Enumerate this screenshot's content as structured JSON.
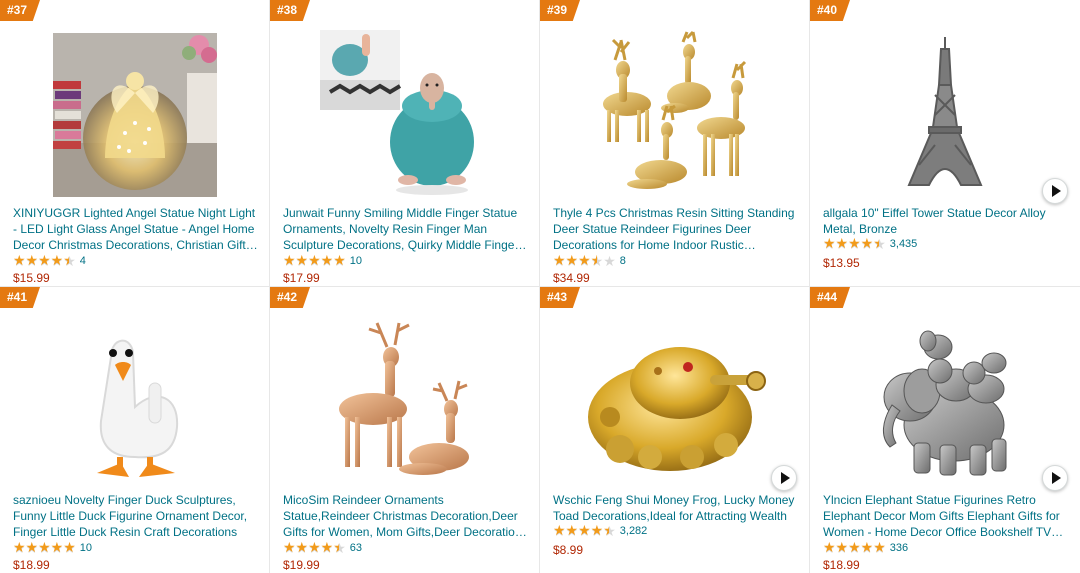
{
  "products": [
    {
      "rank": "#37",
      "title": "XINIYUGGR Lighted Angel Statue Night Light - LED Light Glass Angel Statue - Angel Home Decor Christmas Decorations, Christian Gifts, Angel Gifts, Memorial Gifts, Religious Gifts",
      "rating": 4.5,
      "count": "4",
      "price": "$15.99",
      "image": "angel-glass-night-light"
    },
    {
      "rank": "#38",
      "title": "Junwait Funny Smiling Middle Finger Statue Ornaments, Novelty Resin Finger Man Sculpture Decorations, Quirky Middle Finger Figurines",
      "rating": 5,
      "count": "10",
      "price": "$17.99",
      "image": "teal-finger-man"
    },
    {
      "rank": "#39",
      "title": "Thyle 4 Pcs Christmas Resin Sitting Standing Deer Statue Reindeer Figurines Deer Decorations for Home Indoor Rustic Christmas Decor",
      "rating": 3.5,
      "count": "8",
      "price": "$34.99",
      "image": "gold-deer-set"
    },
    {
      "rank": "#40",
      "title": "allgala 10\" Eiffel Tower Statue Decor Alloy Metal, Bronze",
      "rating": 4.5,
      "count": "3,435",
      "price": "$13.95",
      "image": "eiffel-tower",
      "video": true
    },
    {
      "rank": "#41",
      "title": "saznioeu Novelty Finger Duck Sculptures, Funny Little Duck Figurine Ornament Decor, Finger Little Duck Resin Craft Decorations",
      "rating": 5,
      "count": "10",
      "price": "$18.99",
      "image": "finger-duck"
    },
    {
      "rank": "#42",
      "title": "MicoSim Reindeer Ornaments Statue,Reindeer Christmas Decoration,Deer Gifts for Women, Mom Gifts,Deer Decorations Applicable Home Decor",
      "rating": 4.5,
      "count": "63",
      "price": "$19.99",
      "image": "rose-gold-reindeer"
    },
    {
      "rank": "#43",
      "title": "Wschic Feng Shui Money Frog, Lucky Money Toad Decorations,Ideal for Attracting Wealth",
      "rating": 4.5,
      "count": "3,282",
      "price": "$8.99",
      "image": "money-frog",
      "video": true
    },
    {
      "rank": "#44",
      "title": "Ylncicn Elephant Statue Figurines Retro Elephant Decor Mom Gifts Elephant Gifts for Women - Home Decor Office Bookshelf TV Stand Decorations",
      "rating": 5,
      "count": "336",
      "price": "$18.99",
      "image": "elephant-family",
      "video": true
    }
  ],
  "colors": {
    "accent": "#e47911",
    "link": "#007185",
    "price": "#b12704",
    "star": "#f29b1a"
  },
  "icons": {
    "star": "star-icon",
    "play": "play-video-icon"
  }
}
